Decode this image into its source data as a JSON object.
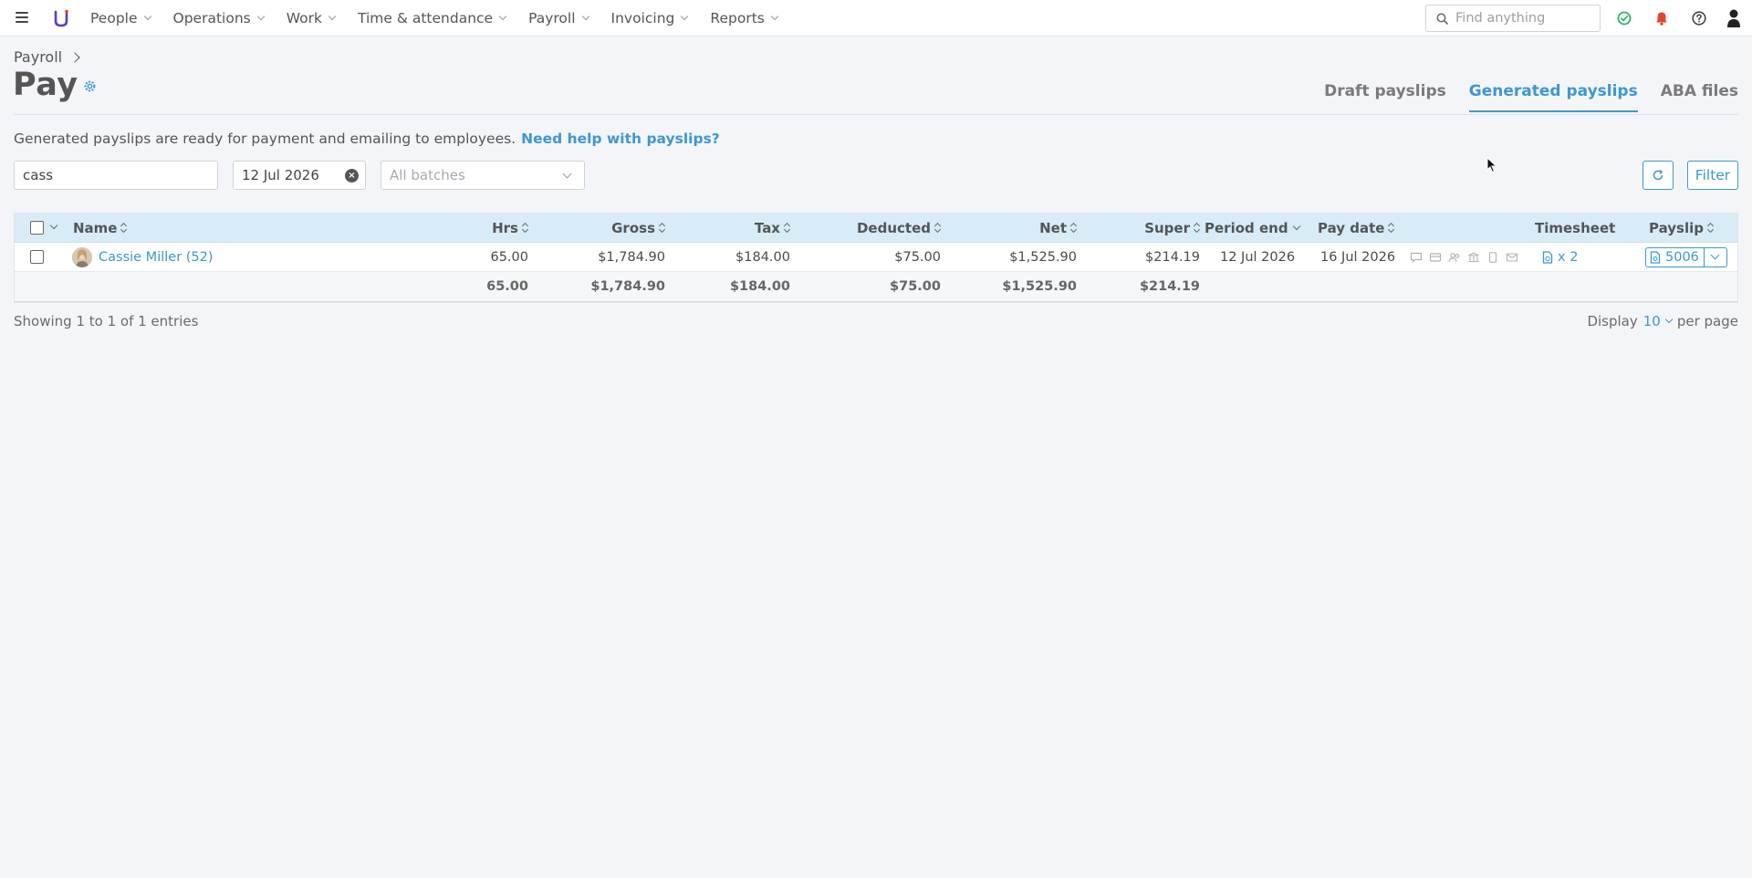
{
  "nav": {
    "items": [
      {
        "label": "People"
      },
      {
        "label": "Operations"
      },
      {
        "label": "Work"
      },
      {
        "label": "Time & attendance"
      },
      {
        "label": "Payroll"
      },
      {
        "label": "Invoicing"
      },
      {
        "label": "Reports"
      }
    ],
    "search_placeholder": "Find anything",
    "icons": [
      "menu-icon",
      "logo",
      "search-icon",
      "status-check-icon",
      "bell-icon",
      "help-icon",
      "user-icon"
    ],
    "colors": {
      "status": "#2fb56a",
      "bell": "#e2452f",
      "logo": "#5b3cc4"
    }
  },
  "header": {
    "breadcrumb": "Payroll",
    "title": "Pay",
    "tabs": [
      {
        "label": "Draft payslips",
        "active": false
      },
      {
        "label": "Generated payslips",
        "active": true
      },
      {
        "label": "ABA files",
        "active": false
      }
    ]
  },
  "intro": {
    "text": "Generated payslips are ready for payment and emailing to employees.",
    "help_link": "Need help with payslips?"
  },
  "filters": {
    "search_value": "cass",
    "date_value": "12 Jul 2026",
    "batch_placeholder": "All batches",
    "filter_label": "Filter"
  },
  "table": {
    "columns": {
      "name": "Name",
      "hrs": "Hrs",
      "gross": "Gross",
      "tax": "Tax",
      "deducted": "Deducted",
      "net": "Net",
      "super": "Super",
      "period_end": "Period end",
      "pay_date": "Pay date",
      "timesheet": "Timesheet",
      "payslip": "Payslip"
    },
    "rows": [
      {
        "name": "Cassie Miller (52)",
        "hrs": "65.00",
        "gross": "$1,784.90",
        "tax": "$184.00",
        "deducted": "$75.00",
        "net": "$1,525.90",
        "super": "$214.19",
        "period_end": "12 Jul 2026",
        "pay_date": "16 Jul 2026",
        "timesheet": "x 2",
        "payslip": "5006"
      }
    ],
    "totals": {
      "hrs": "65.00",
      "gross": "$1,784.90",
      "tax": "$184.00",
      "deducted": "$75.00",
      "net": "$1,525.90",
      "super": "$214.19"
    }
  },
  "footer": {
    "showing": "Showing 1 to 1 of 1 entries",
    "display_label": "Display",
    "per_page_value": "10",
    "per_page_label": "per page"
  },
  "accent_color": "#3d98cf"
}
